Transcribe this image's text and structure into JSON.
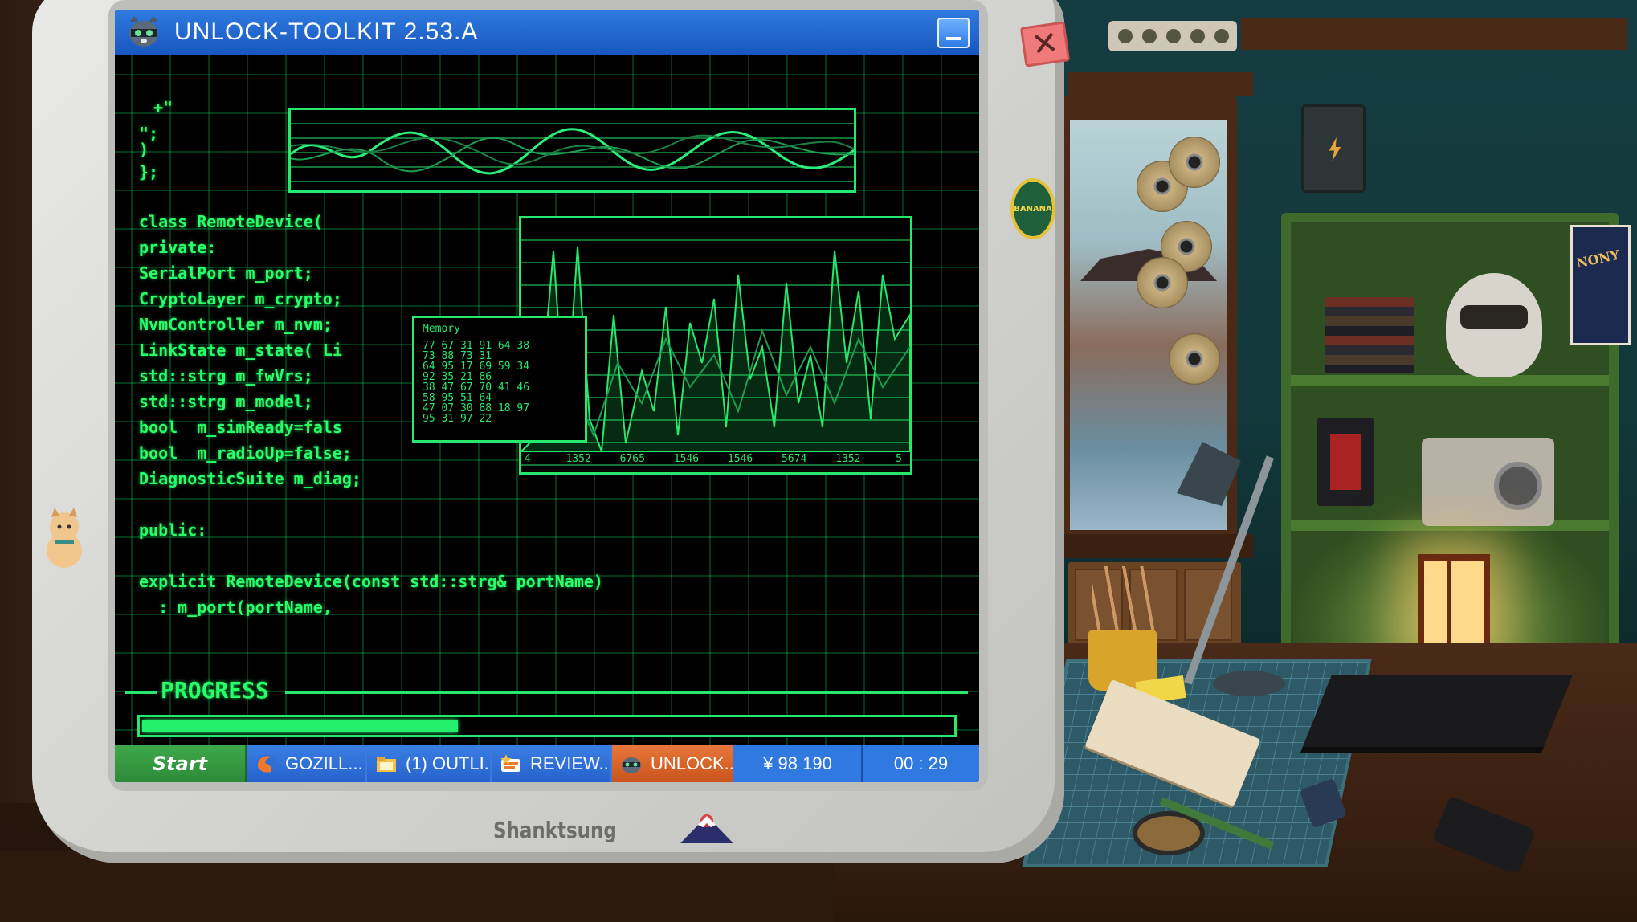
{
  "window": {
    "title": "UNLOCK-TOOLKIT 2.53.A"
  },
  "code": {
    "lines": [
      "+\"",
      "\";",
      ")",
      "};",
      "",
      "class RemoteDevice(",
      "private:",
      "SerialPort m_port;",
      "CryptoLayer m_crypto;",
      "NvmController m_nvm;",
      "LinkState m_state( Li",
      "std::strg m_fwVrs;",
      "std::strg m_model;",
      "bool  m_simReady=fals",
      "bool  m_radioUp=false;",
      "DiagnosticSuite m_diag;",
      "",
      "public:",
      "",
      "explicit RemoteDevice(const std::strg& portName)",
      "  : m_port(portName,"
    ]
  },
  "memory": {
    "title": "Memory",
    "rows": [
      "77 67 31 91 64 38",
      "73 88 73 31",
      "64 95 17 69 59 34",
      "92 35 21 86",
      "38 47 67 70 41 46",
      "58 95 51 64",
      "47 07 30 88 18 97",
      "95 31 97 22"
    ]
  },
  "spike_chart": {
    "ticks": [
      "4",
      "1352",
      "6765",
      "1546",
      "1546",
      "5674",
      "1352",
      "5"
    ]
  },
  "progress": {
    "label": "PROGRESS",
    "value": 0.39
  },
  "taskbar": {
    "start_label": "Start",
    "tasks": [
      {
        "label": "GOZILL..."
      },
      {
        "label": "(1) OUTLI..."
      },
      {
        "label": "REVIEW..."
      },
      {
        "label": "UNLOCK..."
      }
    ],
    "money": "¥ 98 190",
    "clock": "00 : 29"
  },
  "monitor": {
    "brand": "Shanktsung"
  },
  "stickers": {
    "banana": "BANANA",
    "poster": "NONY"
  },
  "colors": {
    "terminal_green": "#26ff6a",
    "titlebar_blue": "#1856c0",
    "taskbar_active": "#e8763a",
    "start_green": "#3fa84a"
  }
}
